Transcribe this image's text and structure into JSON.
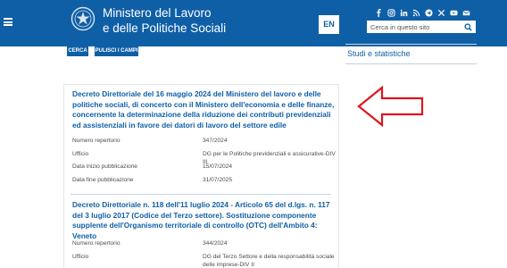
{
  "header": {
    "title_line1": "Ministero del Lavoro",
    "title_line2": "e delle Politiche Sociali",
    "lang": "EN",
    "search_placeholder": "Cerca in questo sito",
    "socials": [
      "facebook-icon",
      "instagram-icon",
      "linkedin-icon",
      "rss-icon",
      "telegram-icon",
      "x-icon",
      "youtube-icon",
      "mail-icon"
    ],
    "brand_color": "#0f5fa6"
  },
  "filters": {
    "search_label": "CERCA",
    "clear_label": "PULISCI I CAMPI"
  },
  "sidebar": {
    "link": "Studi e statistiche"
  },
  "results": [
    {
      "title": "Decreto Direttoriale del 16 maggio 2024 del Ministero del lavoro e delle politiche sociali, di concerto con il Ministero dell'economia e delle finanze, concernente la determinazione della riduzione dei contributi previdenziali ed assistenziali in favore dei datori di lavoro del settore edile",
      "meta": [
        {
          "label": "Numero repertorio",
          "value": "347/2024"
        },
        {
          "label": "Ufficio",
          "value": "DG per le Politiche previdenziali e assicurative-DIV III"
        },
        {
          "label": "Data inizio pubblicazione",
          "value": "15/07/2024"
        },
        {
          "label": "Data fine pubblicazione",
          "value": "31/07/2025"
        }
      ]
    },
    {
      "title": "Decreto Direttoriale n. 118 dell'11 luglio 2024 - Articolo 65 del d.lgs. n. 117 del 3 luglio 2017 (Codice del Terzo settore). Sostituzione componente supplente dell'Organismo territoriale di controllo (OTC) dell'Ambito 4: Veneto",
      "meta": [
        {
          "label": "Numero repertorio",
          "value": "344/2024"
        },
        {
          "label": "Ufficio",
          "value": "DG del Terzo Settore e della responsabilità sociale delle imprese-DIV II"
        }
      ]
    }
  ],
  "annotation_color": "#e0141e"
}
